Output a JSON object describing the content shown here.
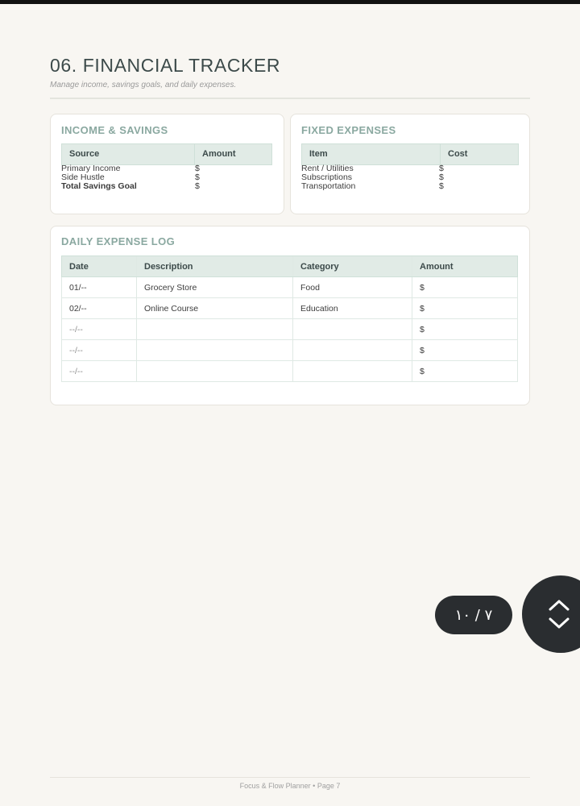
{
  "header": {
    "title": "06. FINANCIAL TRACKER",
    "subtitle": "Manage income, savings goals, and daily expenses."
  },
  "income": {
    "title": "INCOME & SAVINGS",
    "col_source": "Source",
    "col_amount": "Amount",
    "rows": [
      {
        "label": "Primary Income",
        "amount": "$"
      },
      {
        "label": "Side Hustle",
        "amount": "$"
      },
      {
        "label": "Total Savings Goal",
        "amount": "$"
      }
    ]
  },
  "fixed": {
    "title": "FIXED EXPENSES",
    "col_item": "Item",
    "col_cost": "Cost",
    "rows": [
      {
        "label": "Rent / Utilities",
        "amount": "$"
      },
      {
        "label": "Subscriptions",
        "amount": "$"
      },
      {
        "label": "Transportation",
        "amount": "$"
      }
    ]
  },
  "log": {
    "title": "DAILY EXPENSE LOG",
    "headers": [
      "Date",
      "Description",
      "Category",
      "Amount"
    ],
    "rows": [
      [
        "01/--",
        "Grocery Store",
        "Food",
        "$"
      ],
      [
        "02/--",
        "Online Course",
        "Education",
        "$"
      ],
      [
        "--/--",
        "",
        "",
        "$"
      ],
      [
        "--/--",
        "",
        "",
        "$"
      ],
      [
        "--/--",
        "",
        "",
        "$"
      ]
    ]
  },
  "viewer": {
    "page_indicator": "٧ / ١٠"
  },
  "footer": {
    "text": "Focus & Flow Planner • Page 7"
  }
}
